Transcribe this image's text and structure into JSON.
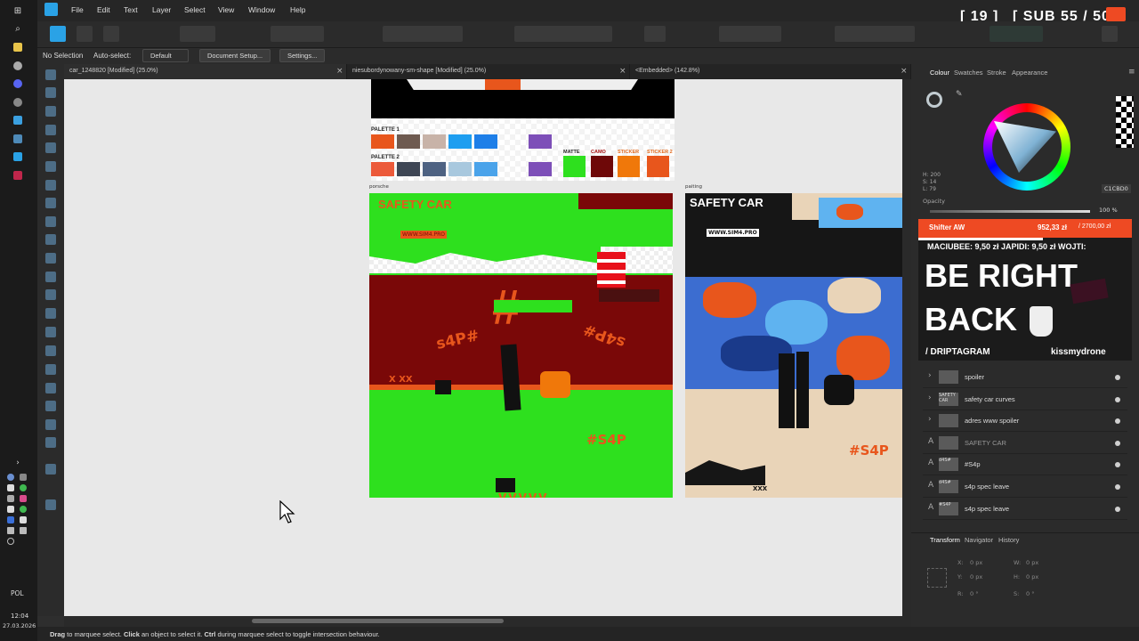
{
  "taskbar": {
    "lang": "POL",
    "time": "12:04",
    "date": "27.03.2026"
  },
  "menu": {
    "items": [
      "File",
      "Edit",
      "Text",
      "Layer",
      "Select",
      "View",
      "Window",
      "Help"
    ]
  },
  "stream": {
    "counter_a": "[ 19 ]",
    "counter_b": "[ SUB 55 / 50 ]"
  },
  "context": {
    "selection": "No Selection",
    "autoselect_label": "Auto-select:",
    "autoselect_value": "Default",
    "doc_setup": "Document Setup...",
    "settings": "Settings..."
  },
  "tabs": [
    {
      "label": "car_1248820 [Modified] (25.0%)"
    },
    {
      "label": "niesubordynowany-sm-shape [Modified] (25.0%)"
    },
    {
      "label": "<Embedded> (142.8%)"
    }
  ],
  "artboard": {
    "palette1": "PALETTE 1",
    "palette2": "PALETTE 2",
    "matte": "MATTE",
    "camo": "CAMO",
    "sticker": "STICKER",
    "sticker2": "STICKER 2",
    "left_label": "porsche",
    "right_label": "paiting",
    "safety": "SAFETY CAR",
    "www": "WWW.SIM4.PRO",
    "hash": "#S4P",
    "xxx": "XXX",
    "xxx2": "X XX",
    "s4p": "s4P#",
    "palette1_colors": [
      "#e8561c",
      "#6e5a50",
      "#c8b3a8",
      "#1e9ef0",
      "#1e7fe8",
      "#7d4fb8"
    ],
    "palette2_colors": [
      "#ec5a3a",
      "#3e4654",
      "#4e6282",
      "#a8c8de",
      "#4aa3ea",
      "#7d4fb8"
    ]
  },
  "panel": {
    "tabs": [
      "Colour",
      "Swatches",
      "Stroke",
      "Appearance"
    ],
    "hsl": [
      "H: 200",
      "S: 14",
      "L: 79"
    ],
    "hex": "C1CBD0",
    "opacity_label": "Opacity",
    "opacity_value": "100 %",
    "layers": [
      {
        "name": "spoiler",
        "thumb": ""
      },
      {
        "name": "safety car curves",
        "thumb": "SAFETY CAR"
      },
      {
        "name": "adres www spoiler",
        "thumb": ""
      },
      {
        "name": "SAFETY CAR",
        "thumb": ""
      },
      {
        "name": "#S4p",
        "thumb": "d4S#"
      },
      {
        "name": "s4p spec leave",
        "thumb": "d4S#"
      },
      {
        "name": "s4p spec leave",
        "thumb": "#S4P"
      }
    ],
    "bottom_tabs": [
      "Transform",
      "Navigator",
      "History"
    ],
    "transform": {
      "x": "0 px",
      "y": "0 px",
      "w": "0 px",
      "h": "0 px",
      "r": "0 °",
      "s": "0 °"
    },
    "tf_labels": {
      "x": "X:",
      "y": "Y:",
      "w": "W:",
      "h": "H:",
      "r": "R:",
      "s": "S:"
    }
  },
  "overlay": {
    "top_name": "Shifter AW",
    "top_amount": "952,33 zł",
    "top_goal": "/ 2700,00 zł",
    "ticker": "MACIUBEE: 9,50 zł   JAPIDI: 9,50 zł   WOJTI:",
    "line1": "BE RIGHT",
    "line2": "BACK",
    "handle": "/ DRIPTAGRAM",
    "handle2": "kissmydrone"
  },
  "status": {
    "drag": "Drag",
    "a": " to marquee select. ",
    "click": "Click",
    "b": " an object to select it. ",
    "ctrl": "Ctrl",
    "c": " during marquee select to toggle intersection behaviour."
  }
}
